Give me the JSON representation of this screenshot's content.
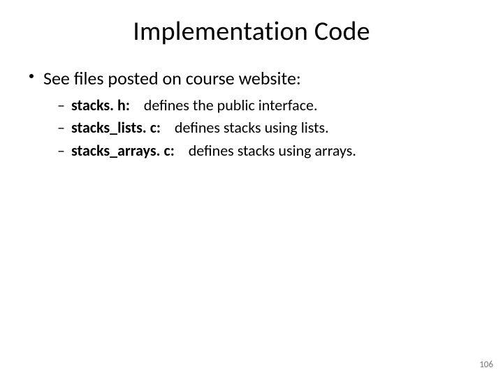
{
  "title": "Implementation Code",
  "body": {
    "intro": "See files posted on course website:",
    "items": [
      {
        "file": "stacks. h:",
        "desc": "defines the public interface."
      },
      {
        "file": "stacks_lists. c:",
        "desc": "defines stacks using lists."
      },
      {
        "file": "stacks_arrays. c:",
        "desc": "defines stacks using arrays."
      }
    ]
  },
  "page_number": "106"
}
